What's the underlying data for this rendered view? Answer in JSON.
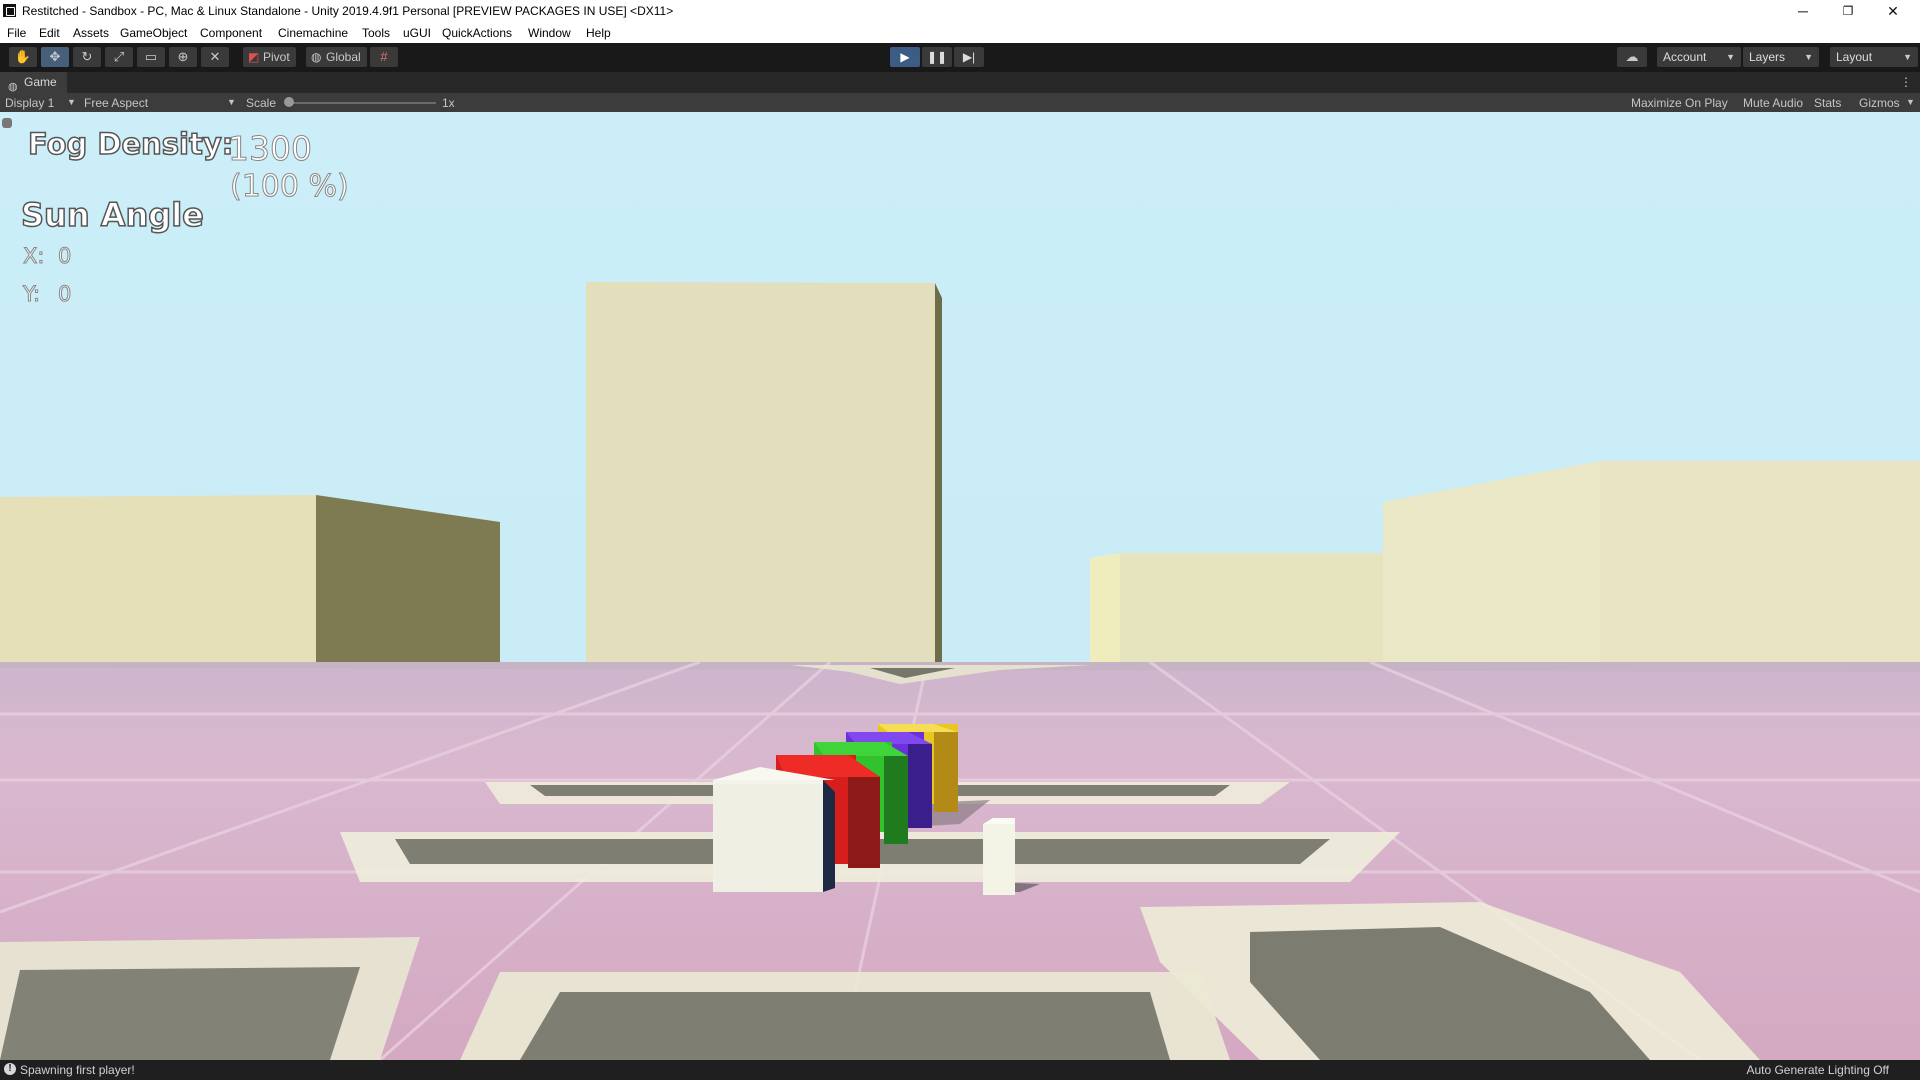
{
  "window": {
    "title": "Restitched - Sandbox - PC, Mac & Linux Standalone - Unity 2019.4.9f1 Personal [PREVIEW PACKAGES IN USE] <DX11>",
    "minimize": "─",
    "maximize": "❐",
    "close": "✕"
  },
  "menu": [
    "File",
    "Edit",
    "Assets",
    "GameObject",
    "Component",
    "Cinemachine",
    "Tools",
    "uGUI",
    "QuickActions",
    "Window",
    "Help"
  ],
  "toolbar": {
    "tools": [
      "hand-tool",
      "move-tool",
      "rotate-tool",
      "scale-tool",
      "rect-tool",
      "transform-tool",
      "custom-tool"
    ],
    "pivot_label": "Pivot",
    "global_label": "Global",
    "account_label": "Account",
    "layers_label": "Layers",
    "layout_label": "Layout"
  },
  "game_tab": {
    "label": "Game",
    "display": "Display 1",
    "aspect": "Free Aspect",
    "scale_label": "Scale",
    "scale_value": "1x",
    "maximize_on_play": "Maximize On Play",
    "mute_audio": "Mute Audio",
    "stats": "Stats",
    "gizmos": "Gizmos"
  },
  "hud": {
    "fog_label": "Fog Density:",
    "fog_value": "1300",
    "fog_percent": "(100 %)",
    "sun_angle_label": "Sun Angle",
    "x_label": "X:",
    "x_value": "0",
    "y_label": "Y:",
    "y_value": "0"
  },
  "status": {
    "message": "Spawning first player!",
    "lighting": "Auto Generate Lighting Off"
  },
  "colors": {
    "sky": "#cbeef8",
    "ground": "#d3aec6",
    "building": "#e6e0b8",
    "cube_white": "#efefe4",
    "cube_red": "#e0201e",
    "cube_green": "#2fc42a",
    "cube_purple": "#6a2fd8",
    "cube_yellow": "#e8c11c",
    "play_active": "#3d5c85"
  }
}
